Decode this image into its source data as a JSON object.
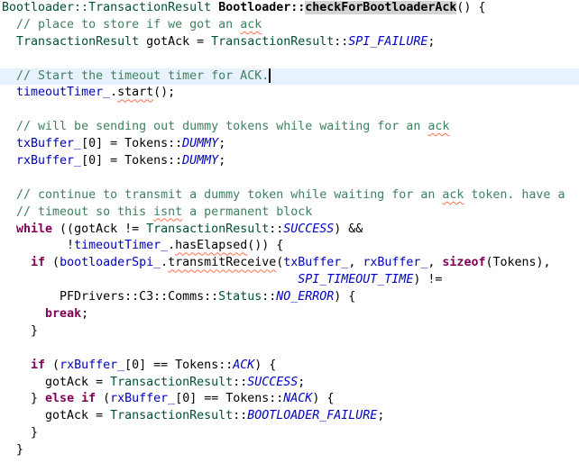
{
  "editor": {
    "current_line": 4,
    "caret_line": 4,
    "lines": [
      [
        [
          "Bootloader::TransactionResult",
          "t"
        ],
        [
          " "
        ],
        [
          "Bootloader::",
          "b"
        ],
        [
          "checkForBootloaderAck",
          "h"
        ],
        [
          "() {"
        ]
      ],
      [
        [
          "  "
        ],
        [
          "// place to store if we got an ",
          "c"
        ],
        [
          "ack",
          "c s"
        ]
      ],
      [
        [
          "  "
        ],
        [
          "TransactionResult",
          "t"
        ],
        [
          " gotAck = "
        ],
        [
          "TransactionResult",
          "t"
        ],
        [
          "::"
        ],
        [
          "SPI_FAILURE",
          "e"
        ],
        [
          ";"
        ]
      ],
      [],
      [
        [
          "  "
        ],
        [
          "// Start the timeout timer for ACK.",
          "c"
        ]
      ],
      [
        [
          "  "
        ],
        [
          "timeoutTimer_",
          "f"
        ],
        [
          "."
        ],
        [
          "start",
          "s"
        ],
        [
          "();"
        ]
      ],
      [],
      [
        [
          "  "
        ],
        [
          "// will be sending out dummy tokens while waiting for an ",
          "c"
        ],
        [
          "ack",
          "c s"
        ]
      ],
      [
        [
          "  "
        ],
        [
          "txBuffer_",
          "f"
        ],
        [
          "[0] = Tokens::"
        ],
        [
          "DUMMY",
          "e"
        ],
        [
          ";"
        ]
      ],
      [
        [
          "  "
        ],
        [
          "rxBuffer_",
          "f"
        ],
        [
          "[0] = Tokens::"
        ],
        [
          "DUMMY",
          "e"
        ],
        [
          ";"
        ]
      ],
      [],
      [
        [
          "  "
        ],
        [
          "// continue to transmit a dummy token while waiting for an ",
          "c"
        ],
        [
          "ack",
          "c s"
        ],
        [
          " token. have a",
          "c"
        ]
      ],
      [
        [
          "  "
        ],
        [
          "// timeout so this ",
          "c"
        ],
        [
          "isnt",
          "c s"
        ],
        [
          " a permanent block",
          "c"
        ]
      ],
      [
        [
          "  "
        ],
        [
          "while",
          "k"
        ],
        [
          " ((gotAck != "
        ],
        [
          "TransactionResult",
          "t"
        ],
        [
          "::"
        ],
        [
          "SUCCESS",
          "e"
        ],
        [
          ") &&"
        ]
      ],
      [
        [
          "         !"
        ],
        [
          "timeoutTimer_",
          "f"
        ],
        [
          "."
        ],
        [
          "hasElapsed",
          "s"
        ],
        [
          "()) {"
        ]
      ],
      [
        [
          "    "
        ],
        [
          "if",
          "k"
        ],
        [
          " ("
        ],
        [
          "bootloaderSpi_",
          "f"
        ],
        [
          "."
        ],
        [
          "transmitReceive",
          "s"
        ],
        [
          "("
        ],
        [
          "txBuffer_",
          "f"
        ],
        [
          ", "
        ],
        [
          "rxBuffer_",
          "f"
        ],
        [
          ", "
        ],
        [
          "sizeof",
          "k"
        ],
        [
          "(Tokens),"
        ]
      ],
      [
        [
          "                                         "
        ],
        [
          "SPI_TIMEOUT_TIME",
          "e"
        ],
        [
          ") !="
        ]
      ],
      [
        [
          "        PFDrivers::C3::Comms::"
        ],
        [
          "Status",
          "t"
        ],
        [
          "::"
        ],
        [
          "NO_ERROR",
          "e"
        ],
        [
          ") {"
        ]
      ],
      [
        [
          "      "
        ],
        [
          "break",
          "k"
        ],
        [
          ";"
        ]
      ],
      [
        [
          "    }"
        ]
      ],
      [],
      [
        [
          "    "
        ],
        [
          "if",
          "k"
        ],
        [
          " ("
        ],
        [
          "rxBuffer_",
          "f"
        ],
        [
          "[0] == Tokens::"
        ],
        [
          "ACK",
          "e"
        ],
        [
          ") {"
        ]
      ],
      [
        [
          "      gotAck = "
        ],
        [
          "TransactionResult",
          "t"
        ],
        [
          "::"
        ],
        [
          "SUCCESS",
          "e"
        ],
        [
          ";"
        ]
      ],
      [
        [
          "    } "
        ],
        [
          "else",
          "k"
        ],
        [
          " "
        ],
        [
          "if",
          "k"
        ],
        [
          " ("
        ],
        [
          "rxBuffer_",
          "f"
        ],
        [
          "[0] == Tokens::"
        ],
        [
          "NACK",
          "e"
        ],
        [
          ") {"
        ]
      ],
      [
        [
          "      gotAck = "
        ],
        [
          "TransactionResult",
          "t"
        ],
        [
          "::"
        ],
        [
          "BOOTLOADER_FAILURE",
          "e"
        ],
        [
          ";"
        ]
      ],
      [
        [
          "    }"
        ]
      ],
      [
        [
          "  }"
        ]
      ]
    ]
  }
}
